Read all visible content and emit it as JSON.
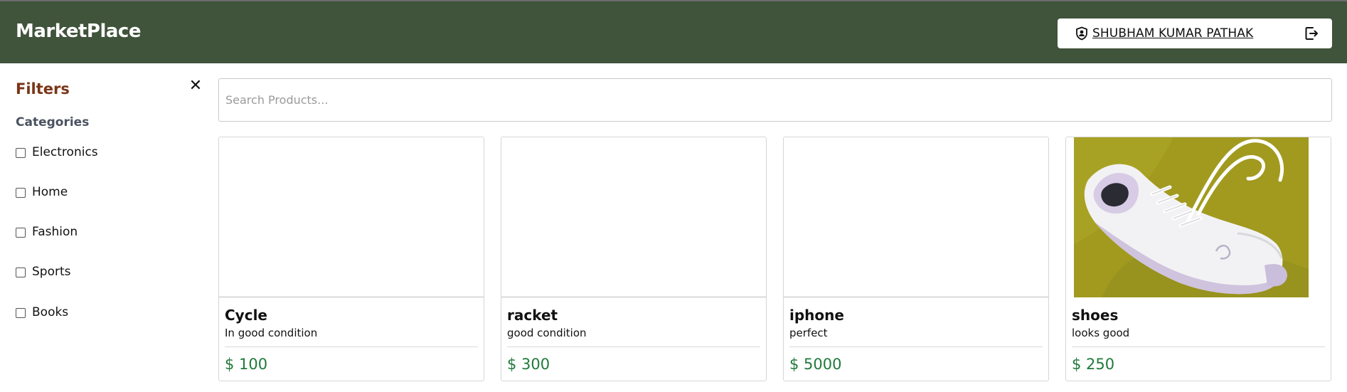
{
  "header": {
    "brand": "MarketPlace",
    "user_name": "SHUBHAM KUMAR PATHAK",
    "user_icon": "user-shield-icon",
    "logout_icon": "logout-icon"
  },
  "sidebar": {
    "title": "Filters",
    "close_icon": "close-icon",
    "categories_title": "Categories",
    "categories": [
      {
        "label": "Electronics",
        "checked": false
      },
      {
        "label": "Home",
        "checked": false
      },
      {
        "label": "Fashion",
        "checked": false
      },
      {
        "label": "Sports",
        "checked": false
      },
      {
        "label": "Books",
        "checked": false
      }
    ]
  },
  "search": {
    "placeholder": "Search Products...",
    "value": ""
  },
  "products": [
    {
      "name": "Cycle",
      "description": "In good condition",
      "price": "$ 100",
      "has_image": false
    },
    {
      "name": "racket",
      "description": "good condition",
      "price": "$ 300",
      "has_image": false
    },
    {
      "name": "iphone",
      "description": "perfect",
      "price": "$ 5000",
      "has_image": false
    },
    {
      "name": "shoes",
      "description": "looks good",
      "price": "$ 250",
      "has_image": true
    }
  ],
  "colors": {
    "header_bg": "#40533b",
    "filters_title": "#7a3516",
    "price": "#1f7a3a"
  }
}
